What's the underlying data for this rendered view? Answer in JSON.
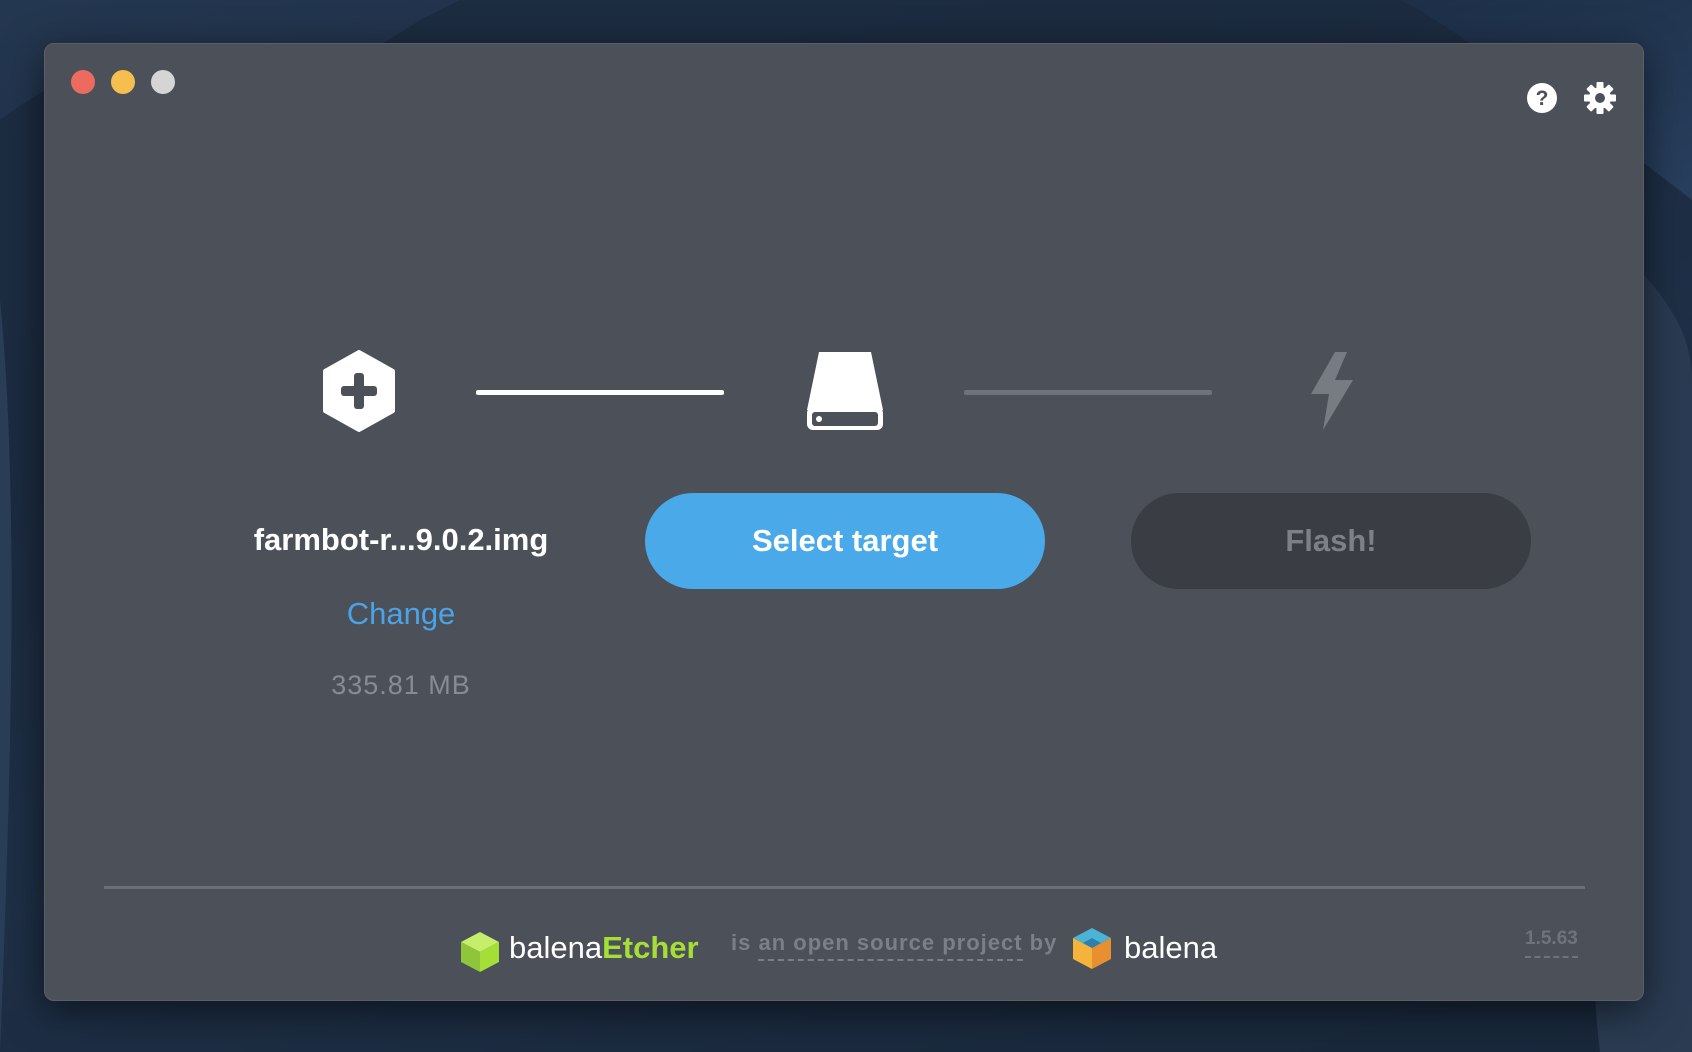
{
  "window": {
    "title_buttons": [
      "close",
      "minimize",
      "maximize"
    ],
    "top_icons": [
      "help-icon",
      "settings-gear-icon"
    ]
  },
  "steps": {
    "image": {
      "icon": "plus-hexagon-icon",
      "filename": "farmbot-r...9.0.2.img",
      "change_label": "Change",
      "size": "335.81 MB"
    },
    "target": {
      "icon": "drive-icon",
      "button_label": "Select target"
    },
    "flash": {
      "icon": "lightning-bolt-icon",
      "button_label": "Flash!"
    }
  },
  "footer": {
    "brand_prefix": "balena",
    "brand_suffix": "Etcher",
    "oss_prefix": "is",
    "oss_link": "an open source project",
    "oss_suffix": "by",
    "company": "balena",
    "version": "1.5.63"
  },
  "colors": {
    "accent": "#4aa9e9",
    "link": "#4aa3e8",
    "etcher_green": "#a5de37",
    "window_bg": "#4c5059"
  }
}
